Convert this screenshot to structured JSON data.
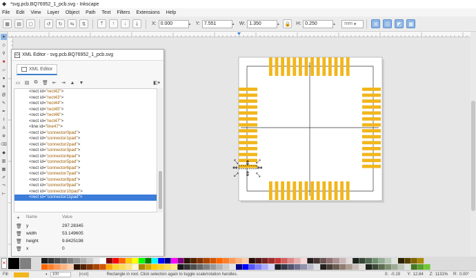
{
  "window": {
    "title": "*svg.pcb.BQ76952_1_pcb.svg - Inkscape"
  },
  "menu": [
    "File",
    "Edit",
    "View",
    "Layer",
    "Object",
    "Path",
    "Text",
    "Filters",
    "Extensions",
    "Help"
  ],
  "toolbar": {
    "x_label": "X:",
    "x_value": "0.000",
    "y_label": "Y:",
    "y_value": "7.551",
    "w_label": "W:",
    "w_value": "1.350",
    "h_label": "H:",
    "h_value": "0.250",
    "units": "mm"
  },
  "xml_editor": {
    "title": "XML Editor - svg.pcb.BQ76952_1_pcb.svg",
    "tab_label": "XML Editor",
    "nodes": [
      {
        "tag": "<rect id=",
        "id": "\"rect42\"",
        "end": ">"
      },
      {
        "tag": "<rect id=",
        "id": "\"rect43\"",
        "end": ">"
      },
      {
        "tag": "<rect id=",
        "id": "\"rect44\"",
        "end": ">"
      },
      {
        "tag": "<rect id=",
        "id": "\"rect45\"",
        "end": ">"
      },
      {
        "tag": "<rect id=",
        "id": "\"rect46\"",
        "end": ">"
      },
      {
        "tag": "<rect id=",
        "id": "\"rect47\"",
        "end": ">"
      },
      {
        "tag": "<line id=",
        "id": "\"line47\"",
        "end": ">"
      },
      {
        "tag": "<rect id=",
        "id": "\"connector0pad\"",
        "end": ">"
      },
      {
        "tag": "<rect id=",
        "id": "\"connector1pad\"",
        "end": ">"
      },
      {
        "tag": "<rect id=",
        "id": "\"connector2pad\"",
        "end": ">"
      },
      {
        "tag": "<rect id=",
        "id": "\"connector3pad\"",
        "end": ">"
      },
      {
        "tag": "<rect id=",
        "id": "\"connector4pad\"",
        "end": ">"
      },
      {
        "tag": "<rect id=",
        "id": "\"connector5pad\"",
        "end": ">"
      },
      {
        "tag": "<rect id=",
        "id": "\"connector6pad\"",
        "end": ">"
      },
      {
        "tag": "<rect id=",
        "id": "\"connector7pad\"",
        "end": ">"
      },
      {
        "tag": "<rect id=",
        "id": "\"connector8pad\"",
        "end": ">"
      },
      {
        "tag": "<rect id=",
        "id": "\"connector9pad\"",
        "end": ">"
      },
      {
        "tag": "<rect id=",
        "id": "\"connector10pad\"",
        "end": ">"
      },
      {
        "tag": "<rect id=",
        "id": "\"connector11pad\"",
        "end": ">",
        "selected": true
      }
    ],
    "attr_header": {
      "name": "Name",
      "value": "Value"
    },
    "attributes": [
      {
        "name": "y",
        "value": "297.28345"
      },
      {
        "name": "width",
        "value": "53.149605"
      },
      {
        "name": "height",
        "value": "9.8425198"
      },
      {
        "name": "x",
        "value": "0"
      }
    ]
  },
  "status": {
    "fill_label": "Fill",
    "opacity": "100",
    "layer": "[root]",
    "message": "Rectangle in root. Click selection again to toggle scale/rotation handles.",
    "x_label": "X:",
    "x_value": "-0.19",
    "y_label": "Y:",
    "y_value": "12.84",
    "zoom_label": "Z:",
    "zoom_value": "1131%",
    "rotation_label": "R:",
    "rotation_value": "0.00°"
  },
  "colors": {
    "pad": "#f2b61c",
    "selection": "#3b7dd8",
    "page": "#ffffff"
  }
}
